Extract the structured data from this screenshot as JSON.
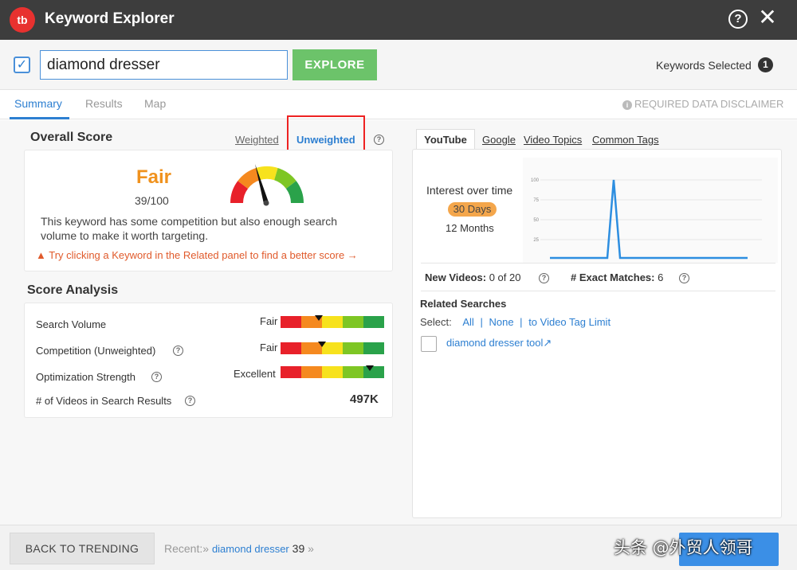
{
  "app": {
    "title": "Keyword Explorer",
    "logo_text": "tb"
  },
  "header": {
    "help_icon": "?",
    "close_icon": "✕"
  },
  "search": {
    "value": "diamond dresser",
    "check_icon": "✓",
    "explore_label": "EXPLORE",
    "keywords_selected_label": "Keywords Selected",
    "keywords_selected_count": "1"
  },
  "tabs": [
    {
      "label": "Summary",
      "active": true
    },
    {
      "label": "Results"
    },
    {
      "label": "Map"
    }
  ],
  "disclaimer": {
    "icon": "i",
    "text": "REQUIRED DATA DISCLAIMER"
  },
  "overall": {
    "title": "Overall Score",
    "weighted_label": "Weighted",
    "unweighted_label": "Unweighted",
    "score_word": "Fair",
    "score_value": "39/100",
    "description": "This keyword has some competition but also enough search volume to make it worth targeting.",
    "tip": "Try clicking a Keyword in the Related panel to find a better score →",
    "warning_icon": "▲"
  },
  "analysis": {
    "title": "Score Analysis",
    "rows": [
      {
        "label": "Search Volume",
        "rating": "Fair",
        "level": 0.37
      },
      {
        "label": "Competition (Unweighted)",
        "rating": "Fair",
        "level": 0.4
      },
      {
        "label": "Optimization Strength",
        "rating": "Excellent",
        "level": 0.86
      },
      {
        "label": "# of Videos in Search Results",
        "value": "497K"
      }
    ],
    "bar_colors": [
      "#e8212a",
      "#f5891f",
      "#f7e21d",
      "#7ec624",
      "#2aa24a"
    ]
  },
  "right": {
    "tabs": [
      {
        "label": "YouTube",
        "active": true
      },
      {
        "label": "Google"
      },
      {
        "label": "Video Topics"
      },
      {
        "label": "Common Tags"
      }
    ],
    "interest_title": "Interest over time",
    "range_active": "30 Days",
    "range_other": "12 Months",
    "chart_ticks": [
      "100",
      "75",
      "50",
      "25"
    ],
    "new_videos_label": "New Videos:",
    "new_videos_value": "0 of 20",
    "exact_label": "# Exact Matches:",
    "exact_value": "6",
    "related_title": "Related Searches",
    "select_label": "Select:",
    "select_all": "All",
    "select_none": "None",
    "select_limit": "to Video Tag Limit",
    "related_keyword": "diamond dresser tool",
    "external_icon": "↗"
  },
  "footer": {
    "back_label": "BACK TO TRENDING",
    "recent_label": "Recent:»",
    "recent_keyword": "diamond dresser",
    "recent_score": "39",
    "recent_more": "»",
    "watermark": "头条 @外贸人领哥"
  }
}
